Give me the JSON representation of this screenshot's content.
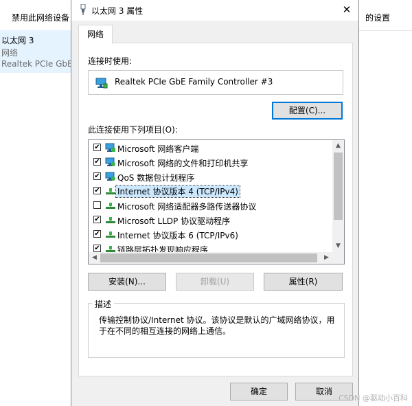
{
  "background": {
    "toolbar_left": "禁用此网络设备",
    "toolbar_right": "的设置",
    "adapter": {
      "name": "以太网 3",
      "status": "网络",
      "device": "Realtek PCIe GbE"
    }
  },
  "dialog": {
    "title": "以太网 3 属性",
    "tab": "网络",
    "connect_using_label": "连接时使用:",
    "device_name": "Realtek PCIe GbE Family Controller #3",
    "configure_button": "配置(C)...",
    "items_label": "此连接使用下列项目(O):",
    "items": [
      {
        "label": "Microsoft 网络客户端",
        "checked": true,
        "icon": "network-client-icon"
      },
      {
        "label": "Microsoft 网络的文件和打印机共享",
        "checked": true,
        "icon": "network-service-icon"
      },
      {
        "label": "QoS 数据包计划程序",
        "checked": true,
        "icon": "network-service-icon"
      },
      {
        "label": "Internet 协议版本 4 (TCP/IPv4)",
        "checked": true,
        "selected": true,
        "icon": "protocol-icon"
      },
      {
        "label": "Microsoft 网络适配器多路传送器协议",
        "checked": false,
        "icon": "protocol-icon"
      },
      {
        "label": "Microsoft LLDP 协议驱动程序",
        "checked": true,
        "icon": "protocol-icon"
      },
      {
        "label": "Internet 协议版本 6 (TCP/IPv6)",
        "checked": true,
        "icon": "protocol-icon"
      },
      {
        "label": "链路层拓扑发现响应程序",
        "checked": true,
        "icon": "protocol-icon"
      }
    ],
    "install_button": "安装(N)...",
    "uninstall_button": "卸载(U)",
    "properties_button": "属性(R)",
    "description_title": "描述",
    "description_text": "传输控制协议/Internet 协议。该协议是默认的广域网络协议，用于在不同的相互连接的网络上通信。",
    "ok_button": "确定",
    "cancel_button": "取消"
  },
  "watermark": "CSDN @驱动小百科",
  "colors": {
    "accent": "#0078d7",
    "selection": "#cce8ff",
    "bg_selection": "#e5f3ff",
    "dialog_bg": "#f0f0f0"
  }
}
